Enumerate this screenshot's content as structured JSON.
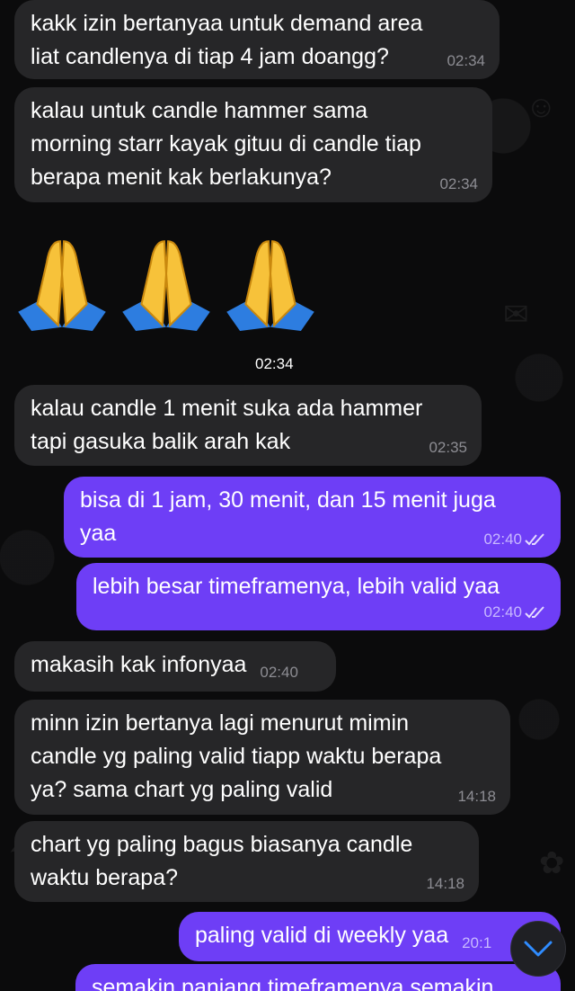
{
  "messages": [
    {
      "text": "kakk izin bertanyaa untuk demand area\nliat candlenya di tiap 4 jam doangg?",
      "time": "02:34"
    },
    {
      "text": "kalau untuk candle hammer sama\nmorning starr kayak gituu di candle tiap\nberapa menit kak berlakunya?",
      "time": "02:34"
    },
    {
      "emoji": "folded-hands",
      "count": 3,
      "time": "02:34"
    },
    {
      "text": "kalau candle 1 menit suka ada hammer\ntapi gasuka balik arah kak",
      "time": "02:35"
    },
    {
      "text": "bisa di 1 jam, 30 menit, dan 15 menit juga\nyaa",
      "time": "02:40"
    },
    {
      "text": "lebih besar timeframenya, lebih valid yaa",
      "time": "02:40"
    },
    {
      "text": "makasih kak infonyaa",
      "time": "02:40"
    },
    {
      "text": "minn izin bertanya lagi menurut mimin\ncandle yg paling valid tiapp waktu berapa\nya? sama chart yg paling valid",
      "time": "14:18"
    },
    {
      "text": "chart yg paling bagus biasanya candle\nwaktu berapa?",
      "time": "14:18"
    },
    {
      "text": "paling valid di weekly yaa",
      "time": "20:1"
    },
    {
      "text": "semakin panjang timeframenya semakin"
    }
  ],
  "icons": {
    "read_receipt": "double-check-icon",
    "scroll_down": "chevron-down-icon",
    "emoji": "folded-hands-emoji"
  },
  "colors": {
    "incoming_bubble": "#262628",
    "outgoing_bubble": "#6e3ef6",
    "background": "#0b0b0c"
  }
}
